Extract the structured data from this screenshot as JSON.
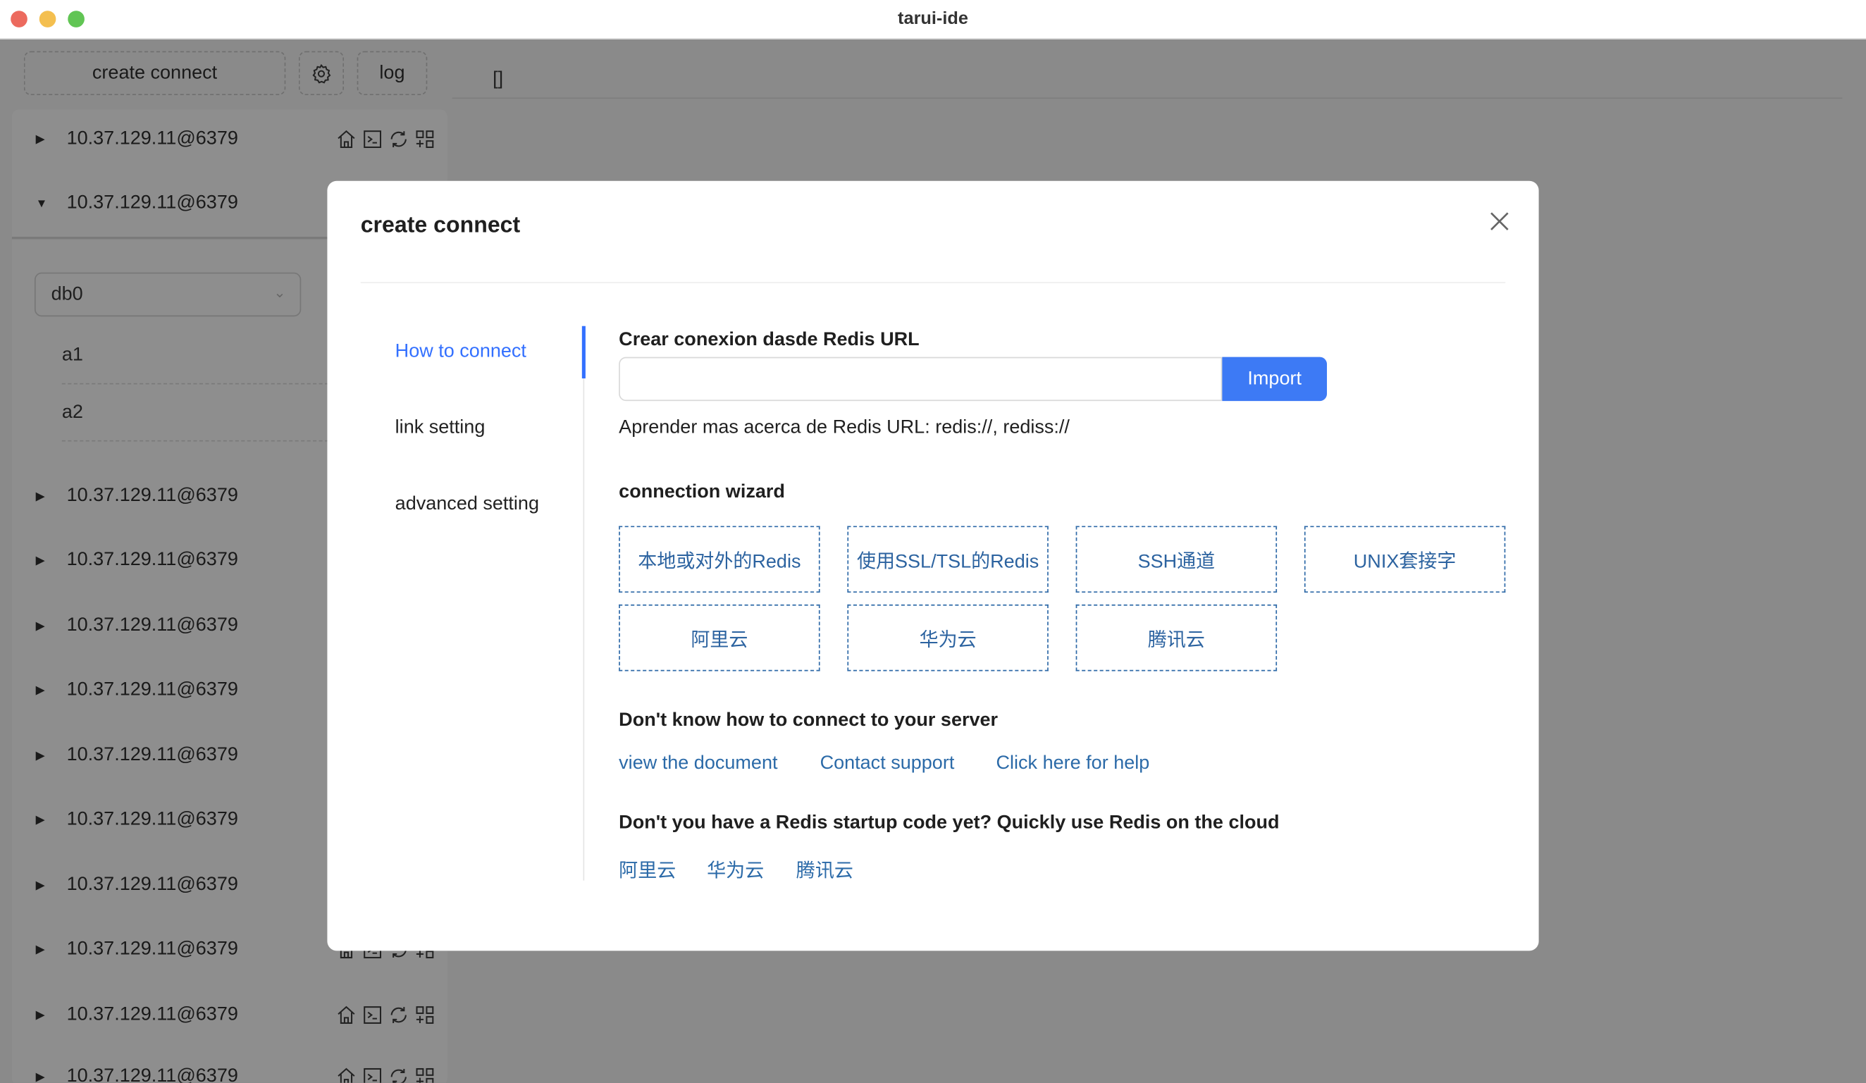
{
  "window": {
    "title": "tarui-ide"
  },
  "toolbar": {
    "create_label": "create connect",
    "settings_icon": "gear-icon",
    "log_label": "log"
  },
  "main": {
    "placeholder_text": "[]"
  },
  "sidebar": {
    "connections": [
      "10.37.129.11@6379",
      "10.37.129.11@6379",
      "10.37.129.11@6379",
      "10.37.129.11@6379",
      "10.37.129.11@6379",
      "10.37.129.11@6379",
      "10.37.129.11@6379",
      "10.37.129.11@6379",
      "10.37.129.11@6379",
      "10.37.129.11@6379",
      "10.37.129.11@6379",
      "10.37.129.11@6379"
    ],
    "db_select": "db0",
    "keys": [
      "a1",
      "a2"
    ]
  },
  "modal": {
    "title": "create connect",
    "tabs": [
      "How to connect",
      "link setting",
      "advanced setting"
    ],
    "active_tab": "How to connect",
    "url_heading": "Crear conexion dasde Redis URL",
    "url_value": "",
    "import_label": "Import",
    "learn_text": "Aprender mas acerca de Redis URL: redis://, rediss://",
    "wizard_heading": "connection wizard",
    "wizard": [
      "本地或对外的Redis",
      "使用SSL/TSL的Redis",
      "SSH通道",
      "UNIX套接字",
      "阿里云",
      "华为云",
      "腾讯云"
    ],
    "help_heading": "Don't know how to connect to your server",
    "help_links": [
      "view the document",
      "Contact support",
      "Click here for help"
    ],
    "cloud_heading": "Don't you have a Redis startup code yet? Quickly use Redis on the cloud",
    "cloud_links": [
      "阿里云",
      "华为云",
      "腾讯云"
    ]
  },
  "colors": {
    "accent": "#3370ff",
    "import_button": "#3d7af5",
    "link": "#2b6aa8"
  }
}
